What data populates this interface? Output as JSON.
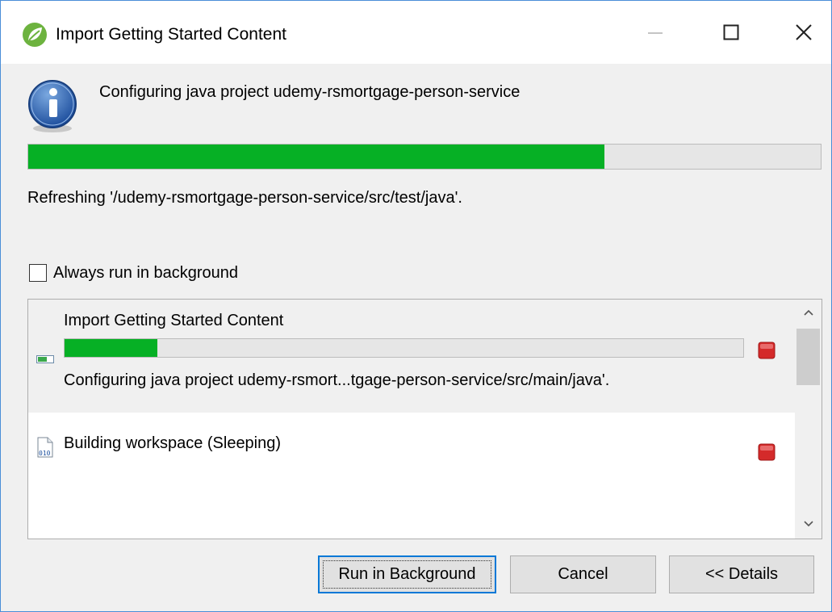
{
  "window": {
    "title": "Import Getting Started Content",
    "controls": {
      "minimize": "minimize-icon",
      "maximize": "maximize-icon",
      "close": "close-icon"
    }
  },
  "header": {
    "icon": "info-icon",
    "message": "Configuring java project udemy-rsmortgage-person-service",
    "progress_fraction": 0.727,
    "subtask": "Refreshing '/udemy-rsmortgage-person-service/src/test/java'."
  },
  "background_option": {
    "label": "Always run in background",
    "checked": false
  },
  "jobs": [
    {
      "name": "Import Getting Started Content",
      "icon": "progress-job-icon",
      "progress_fraction": 0.137,
      "status": "Configuring java project udemy-rsmort...tgage-person-service/src/main/java'."
    },
    {
      "name": "Building workspace (Sleeping)",
      "icon": "binary-file-icon"
    }
  ],
  "buttons": {
    "run_background": "Run in Background",
    "cancel": "Cancel",
    "details": "<< Details"
  },
  "colors": {
    "progress_fill": "#06b025",
    "progress_track": "#e6e6e6",
    "stop_red": "#d42a2a",
    "focus_blue": "#0078d7"
  }
}
